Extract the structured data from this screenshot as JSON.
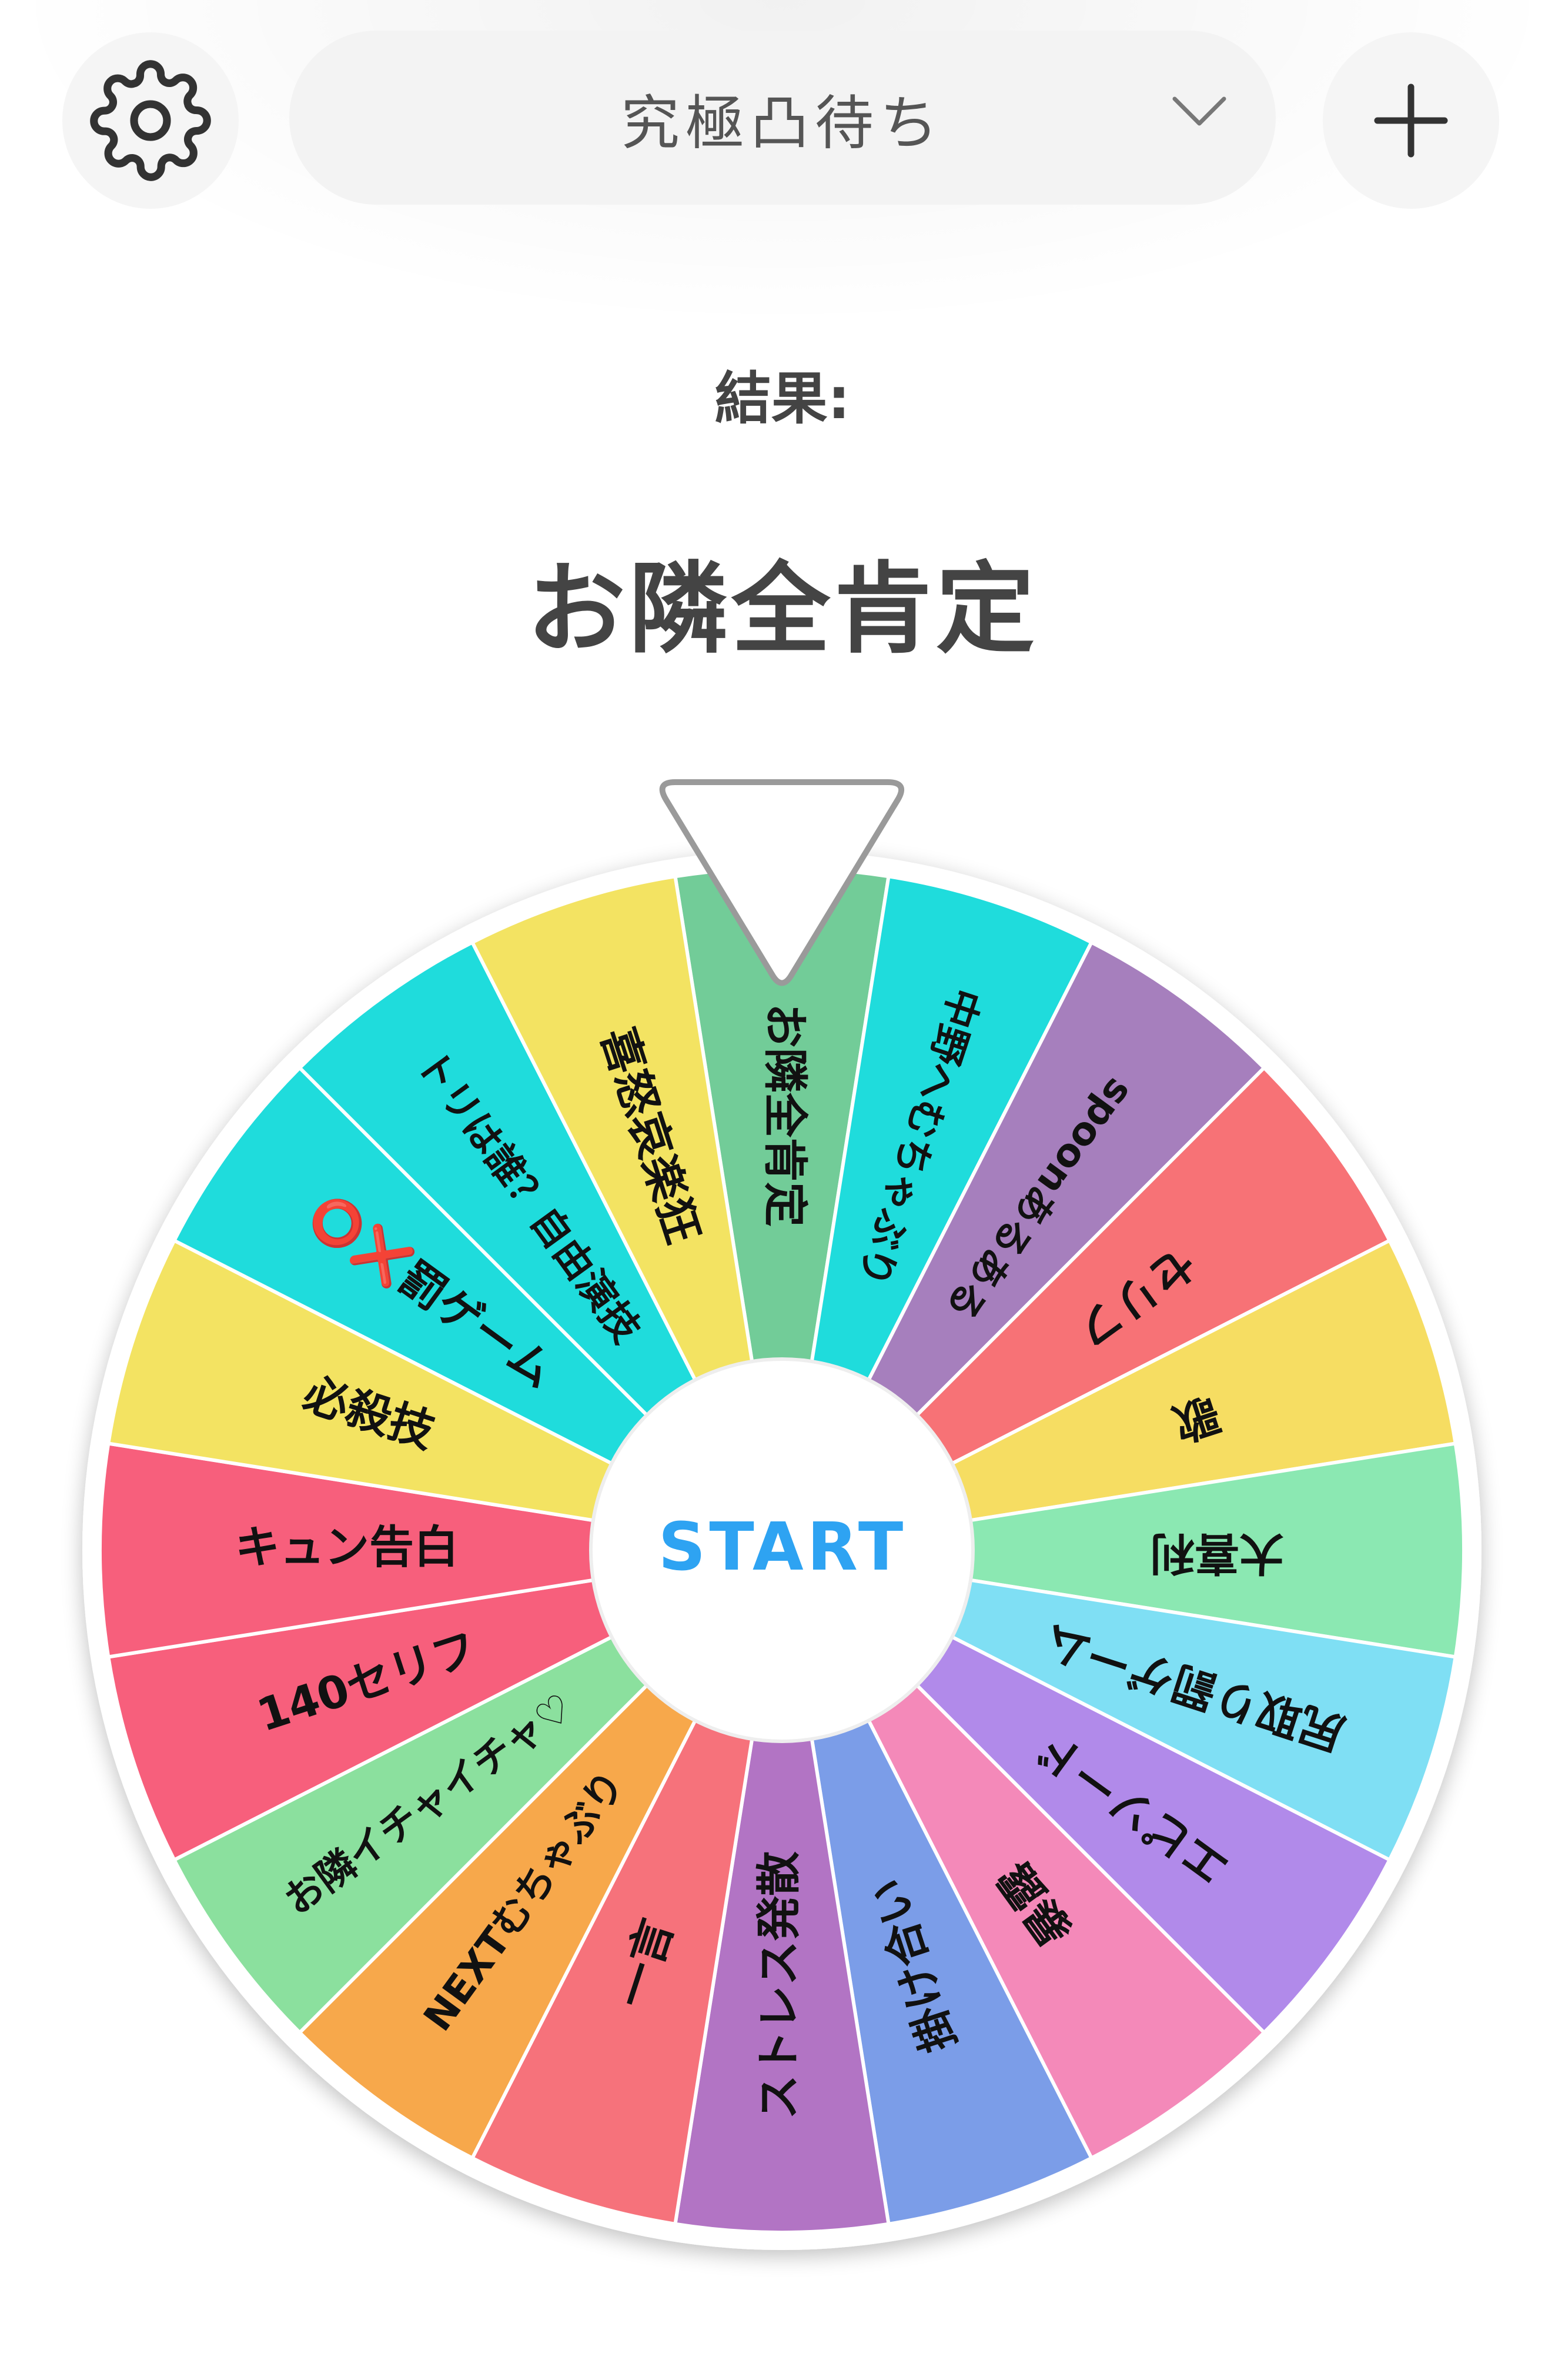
{
  "header": {
    "wheel_name": "究極凸待ち",
    "icons": {
      "settings": "gear-icon",
      "dropdown": "chevron-down-icon",
      "add": "plus-icon"
    }
  },
  "result": {
    "label": "結果:",
    "value": "お隣全肯定"
  },
  "wheel": {
    "start_label": "START",
    "pointer_color": "#ffffff",
    "segments": [
      {
        "label": "お隣全肯定",
        "color": "#72cc98"
      },
      {
        "label": "中野へむちゃぶり",
        "color": "#1fdcdc"
      },
      {
        "label": "spoonあるある",
        "color": "#a67fbd"
      },
      {
        "label": "セリフ",
        "color": "#f77276"
      },
      {
        "label": "歌",
        "color": "#f6dd62"
      },
      {
        "label": "大喜利",
        "color": "#8be8b2"
      },
      {
        "label": "尻取り罰ゲーム",
        "color": "#7fdff4"
      },
      {
        "label": "エピソード",
        "color": "#b18aea"
      },
      {
        "label": "暴露",
        "color": "#f489b9"
      },
      {
        "label": "掛け合い",
        "color": "#7b9de8"
      },
      {
        "label": "ストレス発散",
        "color": "#b274c4"
      },
      {
        "label": "一言",
        "color": "#f6727b"
      },
      {
        "label": "NEXTむちゃぶり",
        "color": "#f7a84b"
      },
      {
        "label": "お隣イチャイチャ♡",
        "color": "#8be09e"
      },
      {
        "label": "140セリフ",
        "color": "#f75f7c"
      },
      {
        "label": "キュン告白",
        "color": "#f75f7c"
      },
      {
        "label": "必殺技",
        "color": "#f3e362"
      },
      {
        "label": "⭕❌罰ゲーム",
        "color": "#1fdcdc"
      },
      {
        "label": "トリは誰？自由演技",
        "color": "#1fdcdc"
      },
      {
        "label": "喜怒哀楽狂",
        "color": "#f3e362"
      }
    ]
  }
}
